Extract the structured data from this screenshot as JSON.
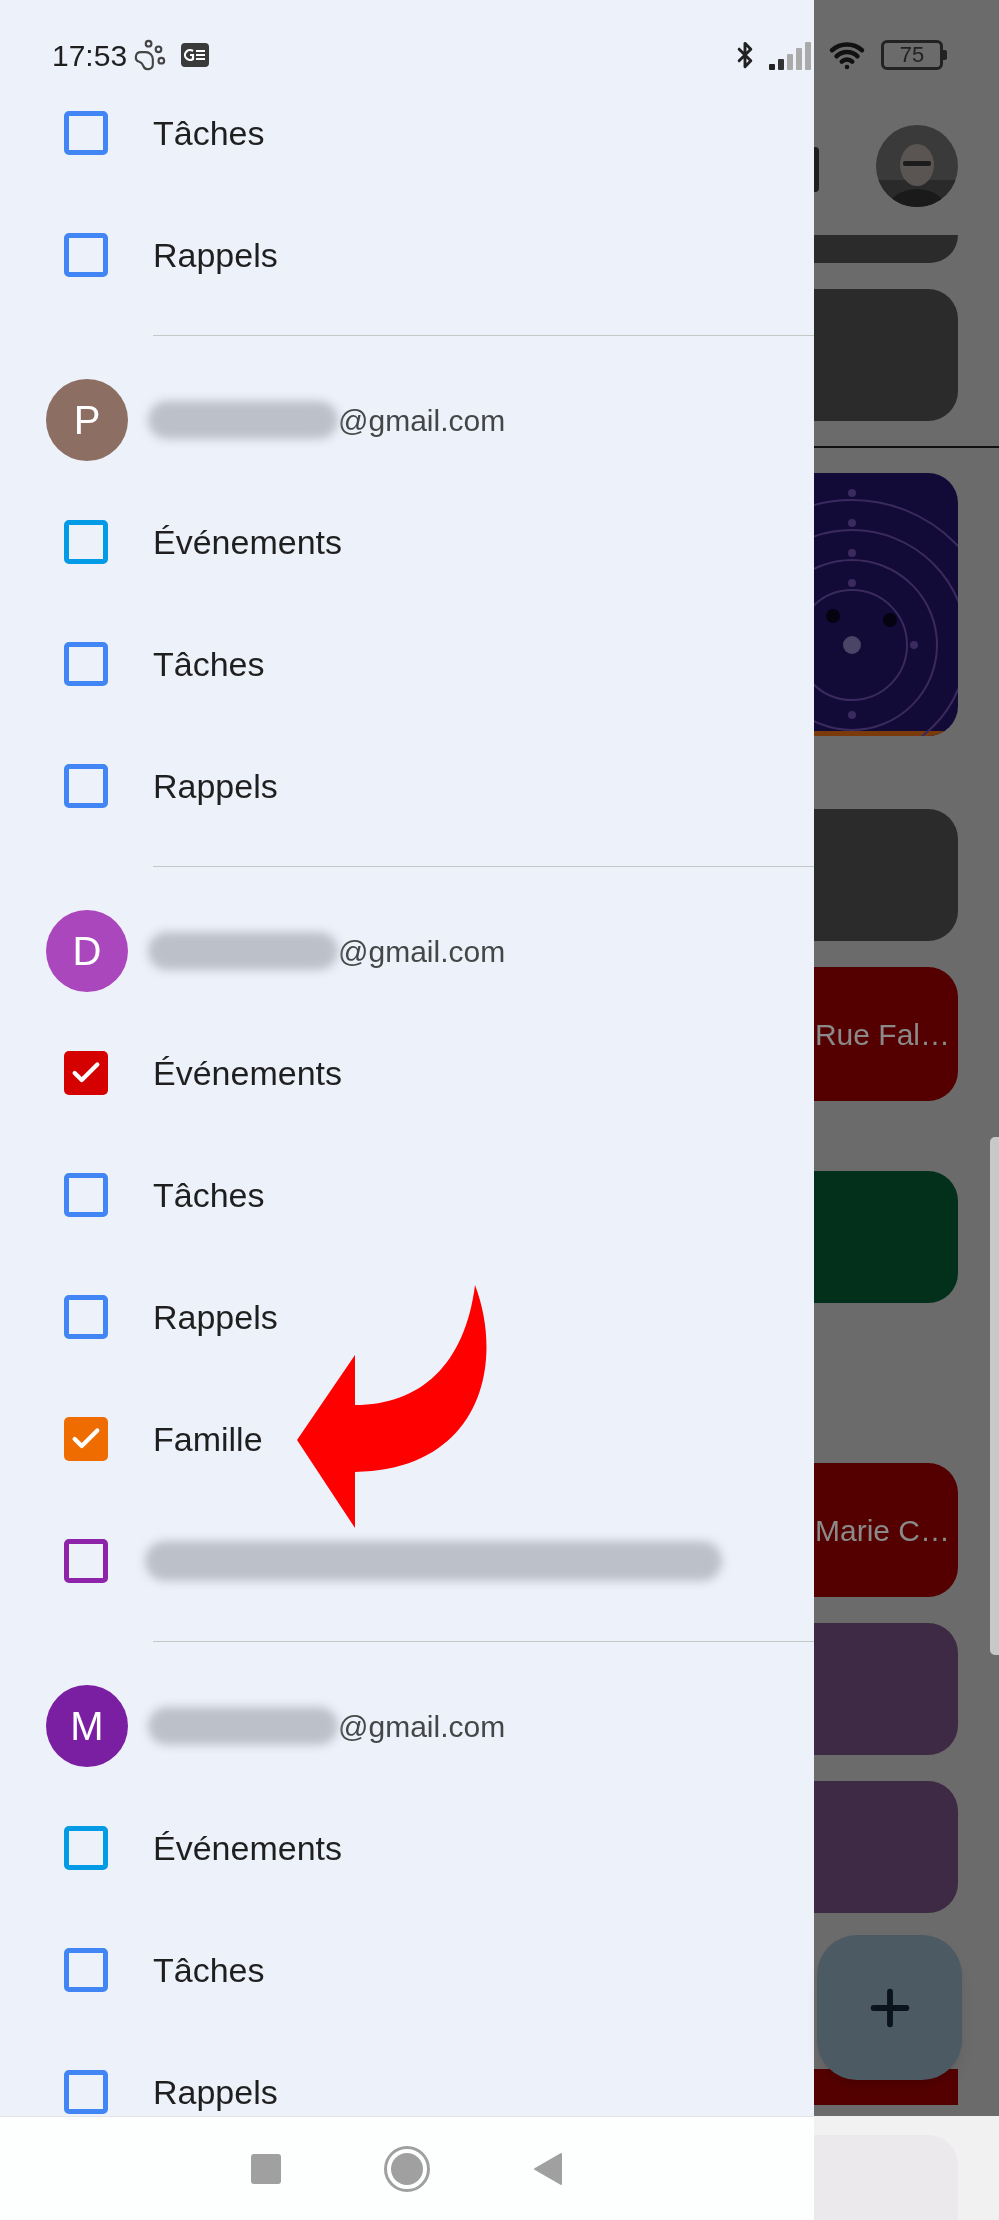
{
  "status_bar": {
    "time": "17:53",
    "battery": "75"
  },
  "drawer": {
    "top_calendars": [
      {
        "kind": "calendar",
        "label": "Tâches",
        "checked": false,
        "color": "#4285f4"
      },
      {
        "kind": "calendar",
        "label": "Rappels",
        "checked": false,
        "color": "#4285f4"
      }
    ],
    "accounts": [
      {
        "avatar_letter": "P",
        "color": "#8d6e63",
        "email_redacted": true,
        "email_suffix": "@gmail.com",
        "calendars": [
          {
            "kind": "calendar",
            "label": "Événements",
            "checked": false,
            "color": "#039be5"
          },
          {
            "kind": "calendar",
            "label": "Tâches",
            "checked": false,
            "color": "#4285f4"
          },
          {
            "kind": "calendar",
            "label": "Rappels",
            "checked": false,
            "color": "#4285f4"
          }
        ]
      },
      {
        "avatar_letter": "D",
        "color": "#ab47bc",
        "email_redacted": true,
        "email_suffix": "@gmail.com",
        "calendars": [
          {
            "kind": "calendar",
            "label": "Événements",
            "checked": true,
            "color": "#d50000"
          },
          {
            "kind": "calendar",
            "label": "Tâches",
            "checked": false,
            "color": "#4285f4"
          },
          {
            "kind": "calendar",
            "label": "Rappels",
            "checked": false,
            "color": "#4285f4"
          },
          {
            "kind": "calendar",
            "label": "Famille",
            "checked": true,
            "color": "#ef6c00"
          },
          {
            "kind": "redacted",
            "checked": false,
            "color": "#8e24aa"
          }
        ]
      },
      {
        "avatar_letter": "M",
        "color": "#7b1fa2",
        "email_redacted": true,
        "email_suffix": "@gmail.com",
        "calendars": [
          {
            "kind": "calendar",
            "label": "Événements",
            "checked": false,
            "color": "#039be5"
          },
          {
            "kind": "calendar",
            "label": "Tâches",
            "checked": false,
            "color": "#4285f4"
          },
          {
            "kind": "calendar",
            "label": "Rappels",
            "checked": false,
            "color": "#4285f4"
          }
        ]
      }
    ]
  },
  "background_app": {
    "days": [
      {
        "divider_before": false,
        "events": [
          {
            "kind": "partial",
            "color": "#2b2b2b"
          },
          {
            "kind": "block",
            "color": "#2b2b2b"
          }
        ]
      },
      {
        "divider_before": true
      },
      {
        "divider_before": false,
        "events": [
          {
            "kind": "block",
            "color": "#2b2b2b"
          },
          {
            "kind": "titled",
            "color": "#550000",
            "title": "Rue Fal…"
          }
        ]
      },
      {
        "divider_before": false,
        "events": [
          {
            "kind": "block",
            "color": "#03301b"
          }
        ]
      },
      {
        "divider_before": false,
        "events": [
          {
            "kind": "titled",
            "color": "#550000",
            "title": "Marie C…"
          },
          {
            "kind": "block",
            "color": "#3e2a44"
          },
          {
            "kind": "block",
            "color": "#3e2a44"
          },
          {
            "kind": "strip",
            "color": "#550000"
          }
        ]
      }
    ]
  }
}
